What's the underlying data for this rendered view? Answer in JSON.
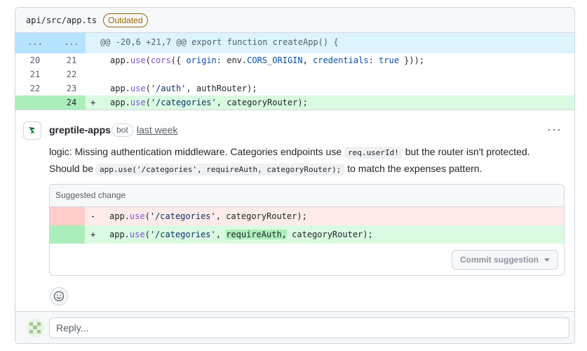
{
  "file": {
    "path": "api/src/app.ts",
    "badge": "Outdated"
  },
  "diff": {
    "hunk": {
      "old": "...",
      "new": "...",
      "text": "@@ -20,6 +21,7 @@ export function createApp() {"
    },
    "lines": [
      {
        "old": "20",
        "new": "21",
        "marker": "",
        "type": "context"
      },
      {
        "old": "21",
        "new": "22",
        "marker": "",
        "type": "context"
      },
      {
        "old": "22",
        "new": "23",
        "marker": "",
        "type": "context"
      },
      {
        "old": "",
        "new": "24",
        "marker": "+",
        "type": "added"
      }
    ]
  },
  "comment": {
    "author": "greptile-apps",
    "badge": "bot",
    "time": "last week",
    "more": "···",
    "body": {
      "p1_a": "logic: Missing authentication middleware. Categories endpoints use ",
      "p1_code": "req.userId!",
      "p1_b": " but the router isn't protected.",
      "p2_a": "Should be ",
      "p2_code": "app.use('/categories', requireAuth, categoryRouter);",
      "p2_b": " to match the expenses pattern."
    }
  },
  "suggestion": {
    "header": "Suggested change",
    "del_marker": "-",
    "del_code": "app.use('/categories', categoryRouter);",
    "ins_marker": "+",
    "ins_pre": "app.use('/categories', ",
    "ins_hl": "requireAuth,",
    "ins_post": " categoryRouter);",
    "commit_label": "Commit suggestion"
  },
  "reply": {
    "placeholder": "Reply..."
  },
  "colors": {
    "added": "#dafbe1",
    "deleted": "#ffebe9",
    "hunk": "#ddf4ff",
    "badge": "#9a6700"
  }
}
